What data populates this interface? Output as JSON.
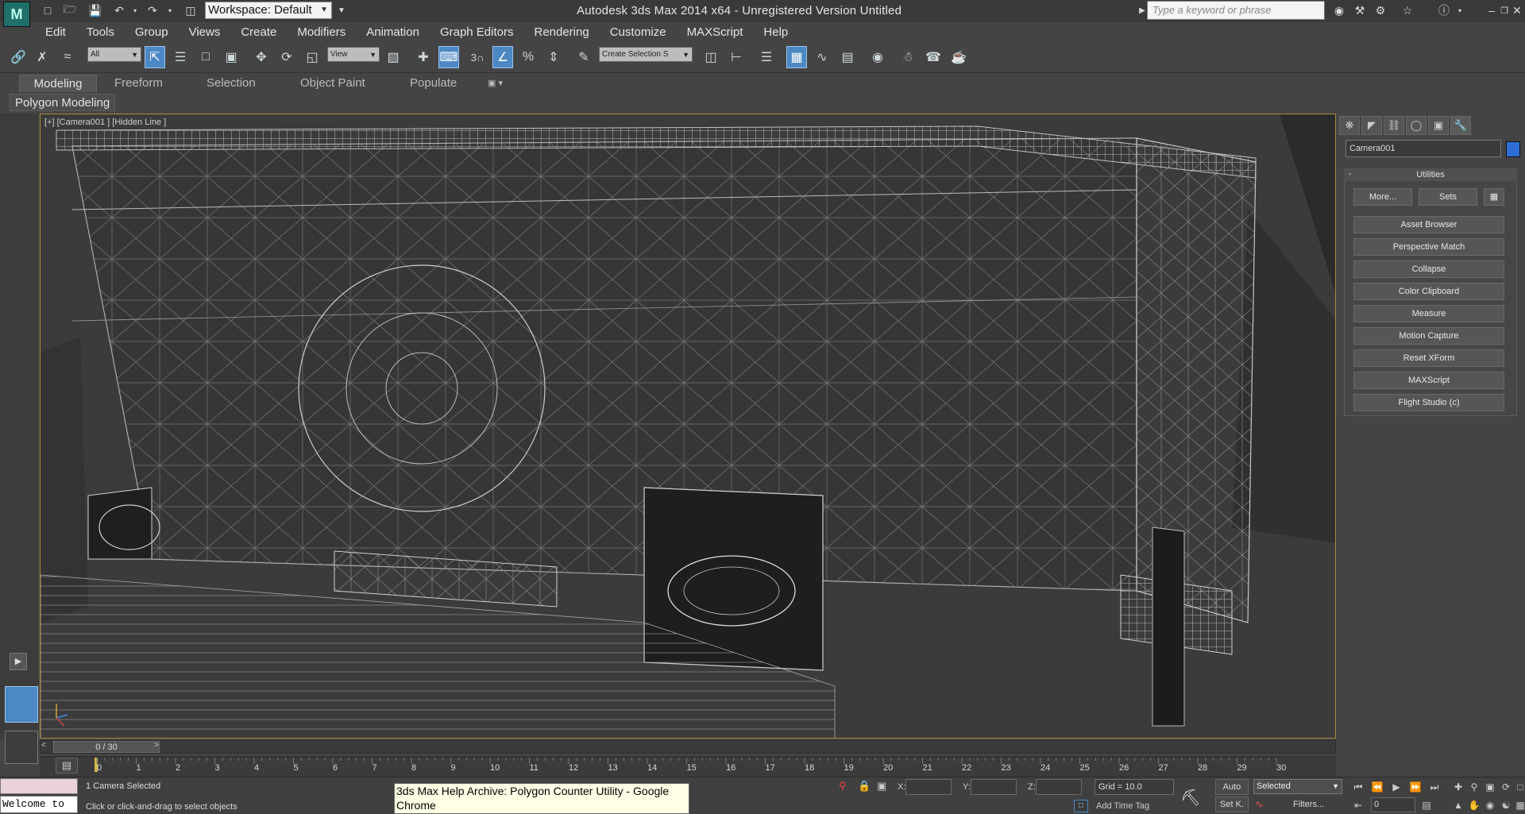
{
  "app": {
    "title": "Autodesk 3ds Max  2014 x64   - Unregistered Version    Untitled",
    "workspace": "Workspace: Default",
    "search_placeholder": "Type a keyword or phrase"
  },
  "menu": [
    "Edit",
    "Tools",
    "Group",
    "Views",
    "Create",
    "Modifiers",
    "Animation",
    "Graph Editors",
    "Rendering",
    "Customize",
    "MAXScript",
    "Help"
  ],
  "toolbar": {
    "selection_filter": "All",
    "reference_coord": "View",
    "named_selection_placeholder": "Create Selection S",
    "snap_label": "3"
  },
  "ribbon": {
    "tabs": [
      "Modeling",
      "Freeform",
      "Selection",
      "Object Paint",
      "Populate"
    ],
    "active_tab": "Modeling",
    "panel": "Polygon Modeling"
  },
  "viewport": {
    "label": "[+] [Camera001 ] [Hidden Line ]",
    "accent_color": "#a88c3a"
  },
  "command_panel": {
    "object_name": "Camera001",
    "object_color": "#2e6fd6",
    "rollout_title": "Utilities",
    "more_button": "More...",
    "sets_button": "Sets",
    "utilities": [
      "Asset Browser",
      "Perspective Match",
      "Collapse",
      "Color Clipboard",
      "Measure",
      "Motion Capture",
      "Reset XForm",
      "MAXScript",
      "Flight Studio (c)"
    ]
  },
  "timeline": {
    "slider_label": "0 / 30",
    "ticks": [
      "0",
      "1",
      "2",
      "3",
      "4",
      "5",
      "6",
      "7",
      "8",
      "9",
      "10",
      "11",
      "12",
      "13",
      "14",
      "15",
      "16",
      "17",
      "18",
      "19",
      "20",
      "21",
      "22",
      "23",
      "24",
      "25",
      "26",
      "27",
      "28",
      "29",
      "30"
    ]
  },
  "status": {
    "maxscript_listener": "Welcome to",
    "selection_info": "1 Camera Selected",
    "prompt": "Click or click-and-drag to select objects",
    "tooltip": "3ds Max Help Archive: Polygon Counter Utility - Google Chrome",
    "x_label": "X:",
    "y_label": "Y:",
    "z_label": "Z:",
    "grid": "Grid = 10.0",
    "add_time_tag": "Add Time Tag",
    "auto_key": "Auto",
    "set_key": "Set K.",
    "key_filter": "Selected",
    "filters": "Filters...",
    "current_frame": "0"
  }
}
